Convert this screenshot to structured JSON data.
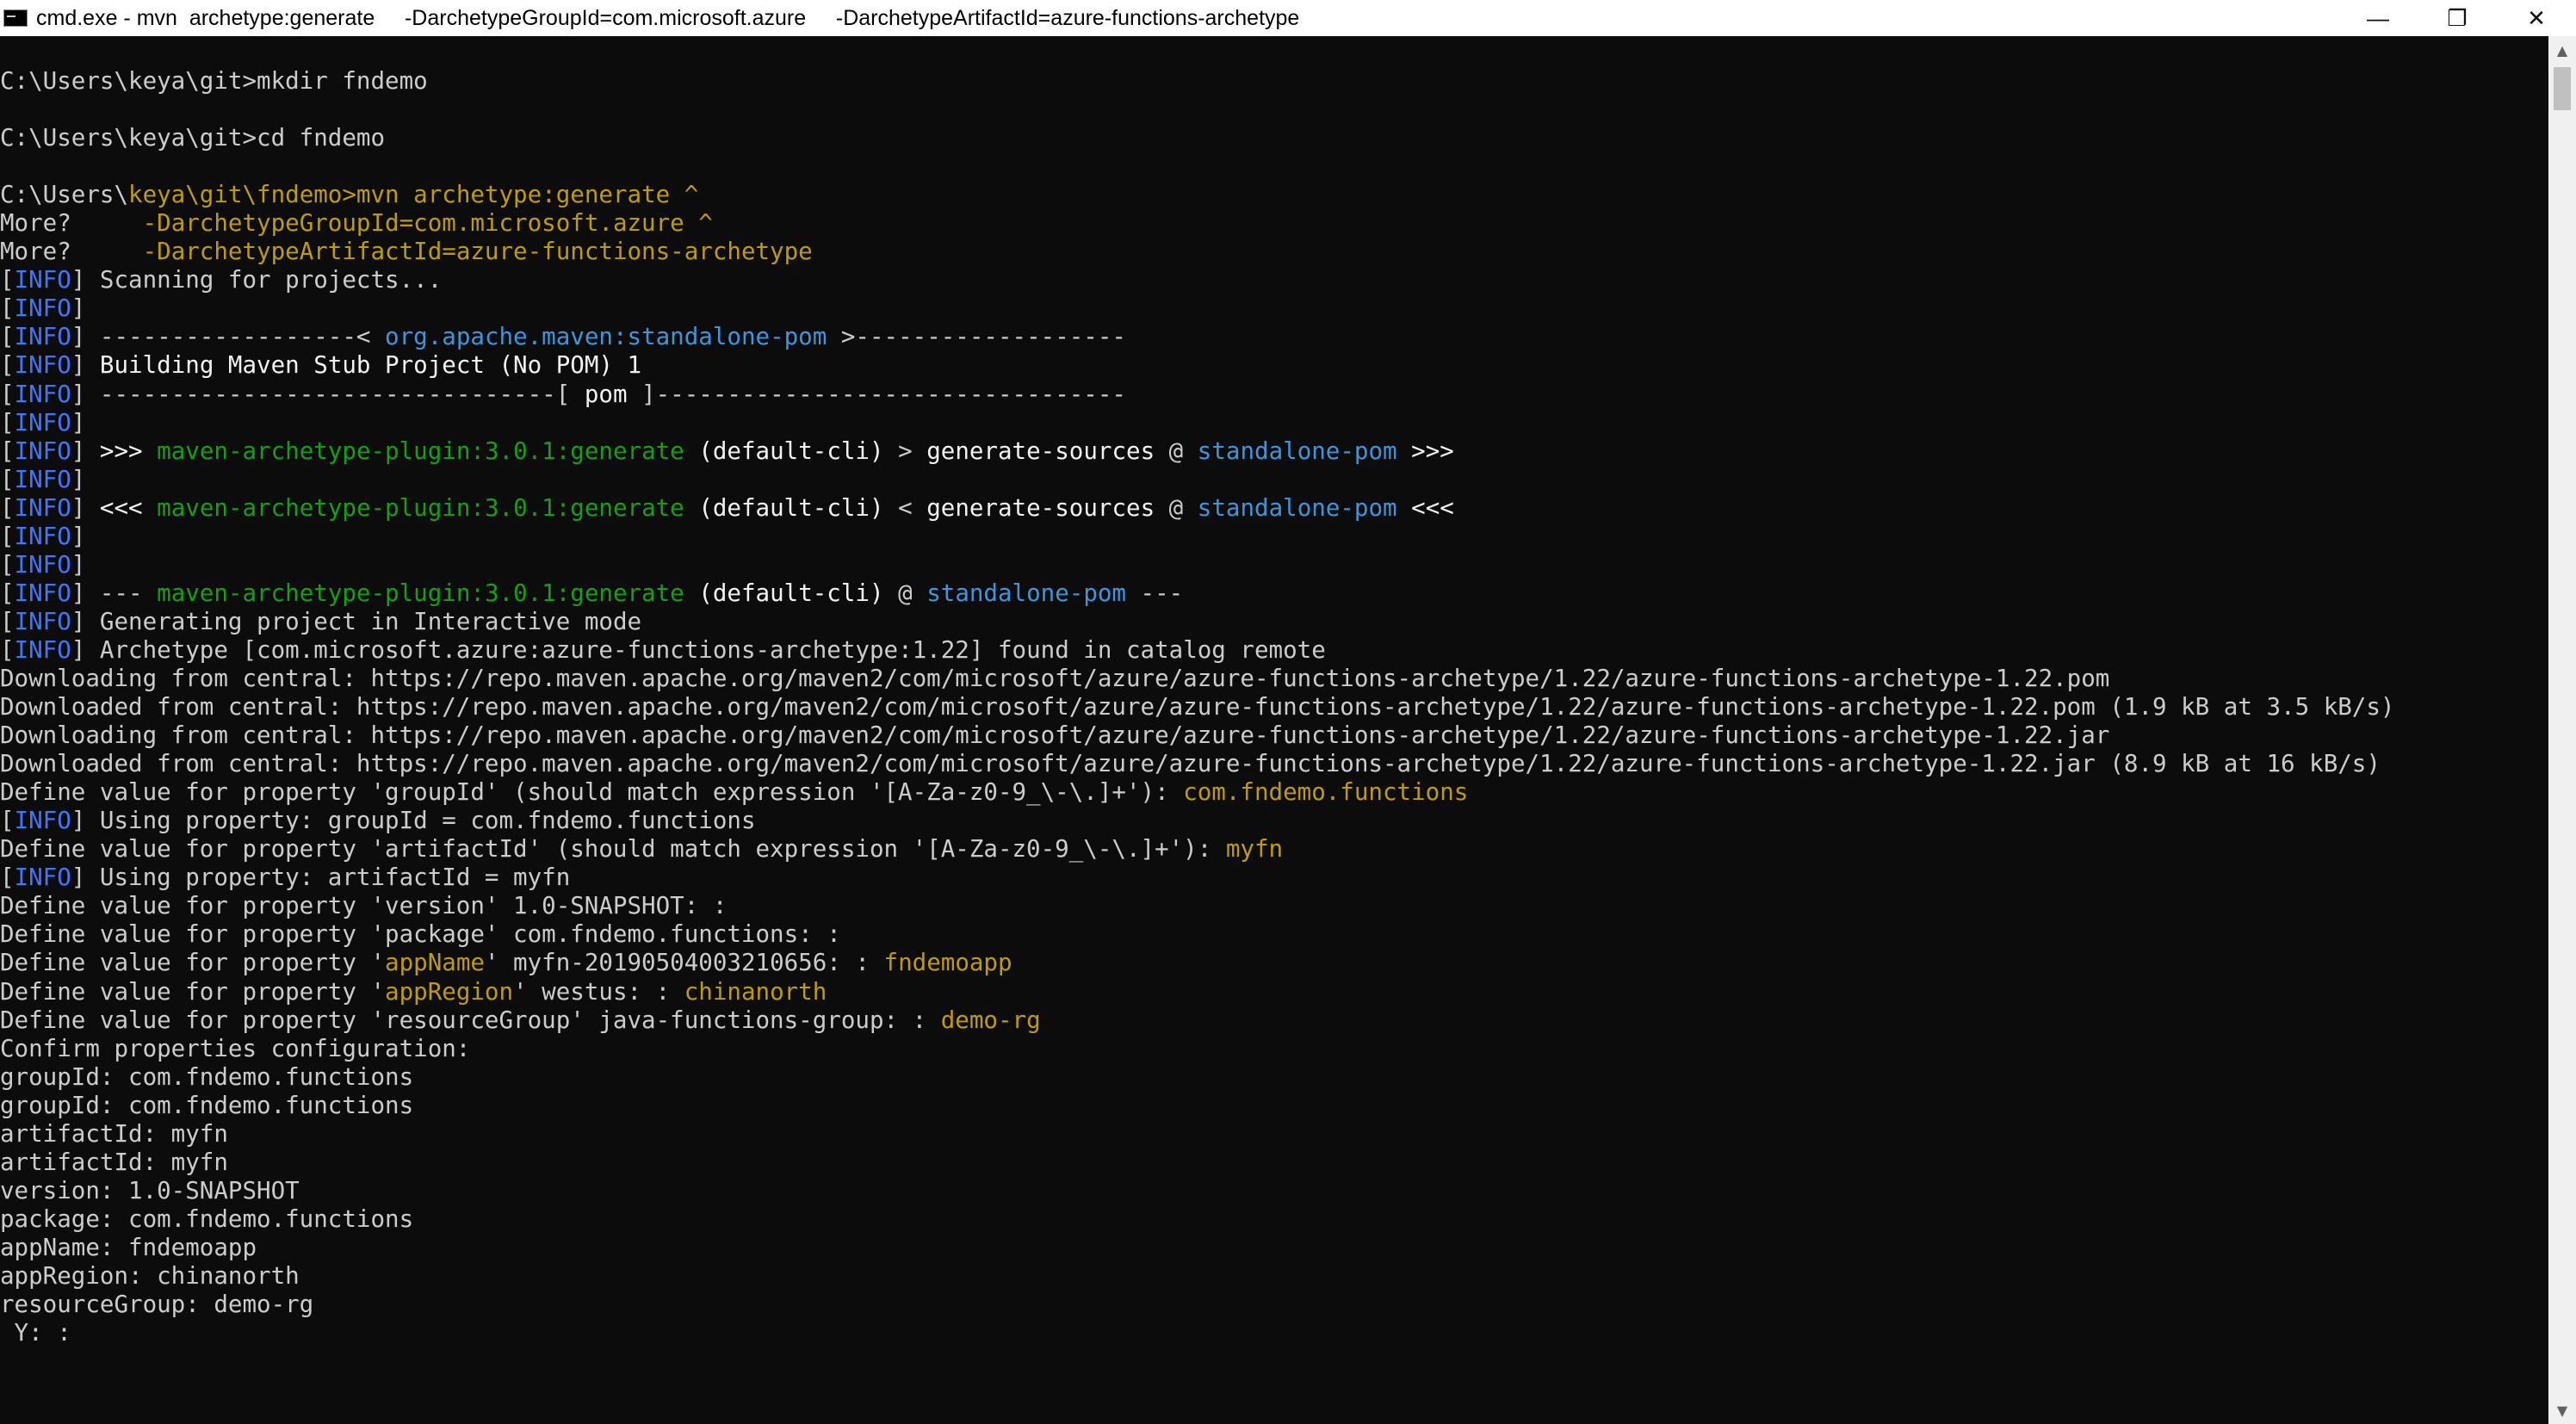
{
  "window": {
    "title": "cmd.exe - mvn  archetype:generate     -DarchetypeGroupId=com.microsoft.azure     -DarchetypeArtifactId=azure-functions-archetype",
    "icon": "cmd-icon",
    "controls": {
      "minimize": "—",
      "maximize": "❐",
      "close": "✕"
    }
  },
  "colors": {
    "background": "#0c0c0c",
    "text": "#cccccc",
    "info": "#3b78ff",
    "input_yellow": "#c19c00",
    "plugin_green": "#13a10e",
    "project_cyan": "#3a96dd"
  },
  "scrollbar": {
    "up": "▲",
    "down": "▼"
  },
  "terminal": {
    "lines": [
      [
        {
          "t": "C:\\Users\\keya\\git>mkdir fndemo",
          "c": "gray"
        }
      ],
      [],
      [
        {
          "t": "C:\\Users\\keya\\git>cd fndemo",
          "c": "gray"
        }
      ],
      [],
      [
        {
          "t": "C:\\Users\\",
          "c": "gray"
        },
        {
          "t": "keya\\git\\fndemo>mvn archetype:generate ^",
          "c": "dyellow"
        }
      ],
      [
        {
          "t": "More?     ",
          "c": "gray"
        },
        {
          "t": "-DarchetypeGroupId=com.microsoft.azure ^",
          "c": "dyellow"
        }
      ],
      [
        {
          "t": "More?     ",
          "c": "gray"
        },
        {
          "t": "-DarchetypeArtifactId=azure-functions-archetype",
          "c": "dyellow"
        }
      ],
      [
        {
          "t": "[",
          "c": "gray"
        },
        {
          "t": "INFO",
          "c": "blue"
        },
        {
          "t": "] Scanning for projects...",
          "c": "gray"
        }
      ],
      [
        {
          "t": "[",
          "c": "gray"
        },
        {
          "t": "INFO",
          "c": "blue"
        },
        {
          "t": "]",
          "c": "gray"
        }
      ],
      [
        {
          "t": "[",
          "c": "gray"
        },
        {
          "t": "INFO",
          "c": "blue"
        },
        {
          "t": "] ------------------< ",
          "c": "gray"
        },
        {
          "t": "org.apache.maven:standalone-pom",
          "c": "cyan"
        },
        {
          "t": " >-------------------",
          "c": "gray"
        }
      ],
      [
        {
          "t": "[",
          "c": "gray"
        },
        {
          "t": "INFO",
          "c": "blue"
        },
        {
          "t": "] ",
          "c": "gray"
        },
        {
          "t": "Building Maven Stub Project (No POM) 1",
          "c": "white"
        }
      ],
      [
        {
          "t": "[",
          "c": "gray"
        },
        {
          "t": "INFO",
          "c": "blue"
        },
        {
          "t": "] --------------------------------[ ",
          "c": "gray"
        },
        {
          "t": "pom",
          "c": "white"
        },
        {
          "t": " ]---------------------------------",
          "c": "gray"
        }
      ],
      [
        {
          "t": "[",
          "c": "gray"
        },
        {
          "t": "INFO",
          "c": "blue"
        },
        {
          "t": "]",
          "c": "gray"
        }
      ],
      [
        {
          "t": "[",
          "c": "gray"
        },
        {
          "t": "INFO",
          "c": "blue"
        },
        {
          "t": "] ",
          "c": "gray"
        },
        {
          "t": ">>>",
          "c": "white"
        },
        {
          "t": " ",
          "c": "gray"
        },
        {
          "t": "maven-archetype-plugin:3.0.1:generate",
          "c": "green"
        },
        {
          "t": " ",
          "c": "gray"
        },
        {
          "t": "(default-cli)",
          "c": "white"
        },
        {
          "t": " > ",
          "c": "gray"
        },
        {
          "t": "generate-sources",
          "c": "white"
        },
        {
          "t": " @ ",
          "c": "gray"
        },
        {
          "t": "standalone-pom",
          "c": "cyan"
        },
        {
          "t": " >>>",
          "c": "white"
        }
      ],
      [
        {
          "t": "[",
          "c": "gray"
        },
        {
          "t": "INFO",
          "c": "blue"
        },
        {
          "t": "]",
          "c": "gray"
        }
      ],
      [
        {
          "t": "[",
          "c": "gray"
        },
        {
          "t": "INFO",
          "c": "blue"
        },
        {
          "t": "] ",
          "c": "gray"
        },
        {
          "t": "<<<",
          "c": "white"
        },
        {
          "t": " ",
          "c": "gray"
        },
        {
          "t": "maven-archetype-plugin:3.0.1:generate",
          "c": "green"
        },
        {
          "t": " ",
          "c": "gray"
        },
        {
          "t": "(default-cli)",
          "c": "white"
        },
        {
          "t": " < ",
          "c": "gray"
        },
        {
          "t": "generate-sources",
          "c": "white"
        },
        {
          "t": " @ ",
          "c": "gray"
        },
        {
          "t": "standalone-pom",
          "c": "cyan"
        },
        {
          "t": " <<<",
          "c": "white"
        }
      ],
      [
        {
          "t": "[",
          "c": "gray"
        },
        {
          "t": "INFO",
          "c": "blue"
        },
        {
          "t": "]",
          "c": "gray"
        }
      ],
      [
        {
          "t": "[",
          "c": "gray"
        },
        {
          "t": "INFO",
          "c": "blue"
        },
        {
          "t": "]",
          "c": "gray"
        }
      ],
      [
        {
          "t": "[",
          "c": "gray"
        },
        {
          "t": "INFO",
          "c": "blue"
        },
        {
          "t": "] --- ",
          "c": "gray"
        },
        {
          "t": "maven-archetype-plugin:3.0.1:generate",
          "c": "green"
        },
        {
          "t": " ",
          "c": "gray"
        },
        {
          "t": "(default-cli)",
          "c": "white"
        },
        {
          "t": " @ ",
          "c": "gray"
        },
        {
          "t": "standalone-pom",
          "c": "cyan"
        },
        {
          "t": " ---",
          "c": "gray"
        }
      ],
      [
        {
          "t": "[",
          "c": "gray"
        },
        {
          "t": "INFO",
          "c": "blue"
        },
        {
          "t": "] Generating project in Interactive mode",
          "c": "gray"
        }
      ],
      [
        {
          "t": "[",
          "c": "gray"
        },
        {
          "t": "INFO",
          "c": "blue"
        },
        {
          "t": "] Archetype [com.microsoft.azure:azure-functions-archetype:1.22] found in catalog remote",
          "c": "gray"
        }
      ],
      [
        {
          "t": "Downloading from central: https://repo.maven.apache.org/maven2/com/microsoft/azure/azure-functions-archetype/1.22/azure-functions-archetype-1.22.pom",
          "c": "gray"
        }
      ],
      [
        {
          "t": "Downloaded from central: https://repo.maven.apache.org/maven2/com/microsoft/azure/azure-functions-archetype/1.22/azure-functions-archetype-1.22.pom (1.9 kB at 3.5 kB/s)",
          "c": "gray"
        }
      ],
      [
        {
          "t": "Downloading from central: https://repo.maven.apache.org/maven2/com/microsoft/azure/azure-functions-archetype/1.22/azure-functions-archetype-1.22.jar",
          "c": "gray"
        }
      ],
      [
        {
          "t": "Downloaded from central: https://repo.maven.apache.org/maven2/com/microsoft/azure/azure-functions-archetype/1.22/azure-functions-archetype-1.22.jar (8.9 kB at 16 kB/s)",
          "c": "gray"
        }
      ],
      [
        {
          "t": "Define value for property 'groupId' (should match expression '[A-Za-z0-9_\\-\\.]+'): ",
          "c": "gray"
        },
        {
          "t": "com.fndemo.functions",
          "c": "dyellow"
        }
      ],
      [
        {
          "t": "[",
          "c": "gray"
        },
        {
          "t": "INFO",
          "c": "blue"
        },
        {
          "t": "] Using property: groupId = com.fndemo.functions",
          "c": "gray"
        }
      ],
      [
        {
          "t": "Define value for property 'artifactId' (should match expression '[A-Za-z0-9_\\-\\.]+'): ",
          "c": "gray"
        },
        {
          "t": "myfn",
          "c": "dyellow"
        }
      ],
      [
        {
          "t": "[",
          "c": "gray"
        },
        {
          "t": "INFO",
          "c": "blue"
        },
        {
          "t": "] Using property: artifactId = myfn",
          "c": "gray"
        }
      ],
      [
        {
          "t": "Define value for property 'version' 1.0-SNAPSHOT: :",
          "c": "gray"
        }
      ],
      [
        {
          "t": "Define value for property 'package' com.fndemo.functions: :",
          "c": "gray"
        }
      ],
      [
        {
          "t": "Define value for property '",
          "c": "gray"
        },
        {
          "t": "appName",
          "c": "dyellow"
        },
        {
          "t": "' myfn-20190504003210656: : ",
          "c": "gray"
        },
        {
          "t": "fndemoapp",
          "c": "dyellow"
        }
      ],
      [
        {
          "t": "Define value for property '",
          "c": "gray"
        },
        {
          "t": "appRegion",
          "c": "dyellow"
        },
        {
          "t": "' westus: : ",
          "c": "gray"
        },
        {
          "t": "chinanorth",
          "c": "dyellow"
        }
      ],
      [
        {
          "t": "Define value for property 'resourceGroup' java-functions-group: : ",
          "c": "gray"
        },
        {
          "t": "demo-rg",
          "c": "dyellow"
        }
      ],
      [
        {
          "t": "Confirm properties configuration:",
          "c": "gray"
        }
      ],
      [
        {
          "t": "groupId: com.fndemo.functions",
          "c": "gray"
        }
      ],
      [
        {
          "t": "groupId: com.fndemo.functions",
          "c": "gray"
        }
      ],
      [
        {
          "t": "artifactId: myfn",
          "c": "gray"
        }
      ],
      [
        {
          "t": "artifactId: myfn",
          "c": "gray"
        }
      ],
      [
        {
          "t": "version: 1.0-SNAPSHOT",
          "c": "gray"
        }
      ],
      [
        {
          "t": "package: com.fndemo.functions",
          "c": "gray"
        }
      ],
      [
        {
          "t": "appName: fndemoapp",
          "c": "gray"
        }
      ],
      [
        {
          "t": "appRegion: chinanorth",
          "c": "gray"
        }
      ],
      [
        {
          "t": "resourceGroup: demo-rg",
          "c": "gray"
        }
      ],
      [
        {
          "t": " Y: :",
          "c": "gray"
        }
      ]
    ]
  }
}
